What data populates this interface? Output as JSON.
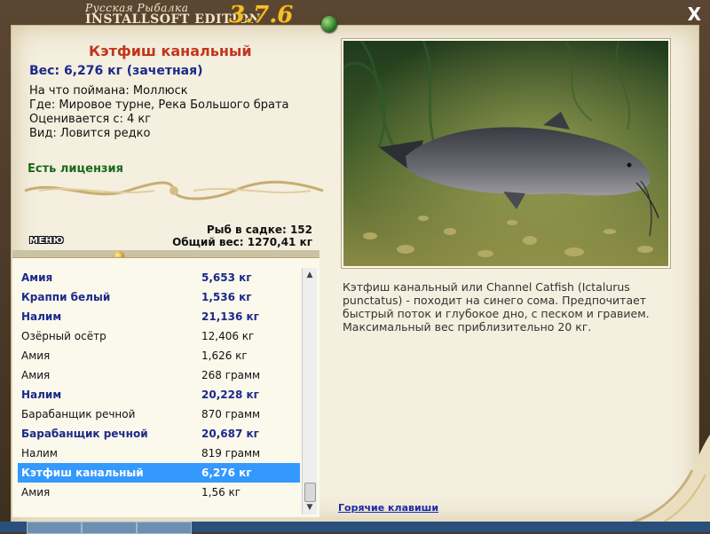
{
  "app": {
    "logo_line1": "Русская Рыбалка",
    "logo_line2": "INSTALLSOFT EDITION",
    "version": "3.7.6",
    "close_glyph": "X"
  },
  "fish": {
    "title": "Кэтфиш канальный",
    "weight": "Вес: 6,276 кг (зачетная)",
    "caught_on": "На что поймана: Моллюск",
    "where": "Где: Мировое турне, Река Большого брата",
    "valued_from": "Оценивается с: 4 кг",
    "kind": "Вид: Ловится редко",
    "license": "Есть лицензия",
    "description": "Кэтфиш канальный или Channel Catfish (Ictalurus punctatus) - походит на синего сома. Предпочитает быстрый поток и глубокое дно, с песком и гравием. Максимальный вес приблизительно 20 кг."
  },
  "menu_label": "МЕНЮ",
  "stats": {
    "fish_in_keepnet": "Рыб в садке: 152",
    "total_weight": "Общий вес: 1270,41 кг"
  },
  "hotkeys_label": "Горячие клавиши",
  "catch_list": [
    {
      "name": "Амия",
      "weight": "5,653 кг",
      "trophy": true,
      "selected": false
    },
    {
      "name": "Краппи белый",
      "weight": "1,536 кг",
      "trophy": true,
      "selected": false
    },
    {
      "name": "Налим",
      "weight": "21,136 кг",
      "trophy": true,
      "selected": false
    },
    {
      "name": "Озёрный осётр",
      "weight": "12,406 кг",
      "trophy": false,
      "selected": false
    },
    {
      "name": "Амия",
      "weight": "1,626 кг",
      "trophy": false,
      "selected": false
    },
    {
      "name": "Амия",
      "weight": "268 грамм",
      "trophy": false,
      "selected": false
    },
    {
      "name": "Налим",
      "weight": "20,228 кг",
      "trophy": true,
      "selected": false
    },
    {
      "name": "Барабанщик речной",
      "weight": "870 грамм",
      "trophy": false,
      "selected": false
    },
    {
      "name": "Барабанщик речной",
      "weight": "20,687 кг",
      "trophy": true,
      "selected": false
    },
    {
      "name": "Налим",
      "weight": "819 грамм",
      "trophy": false,
      "selected": false
    },
    {
      "name": "Кэтфиш канальный",
      "weight": "6,276 кг",
      "trophy": true,
      "selected": true
    },
    {
      "name": "Амия",
      "weight": "1,56 кг",
      "trophy": false,
      "selected": false
    }
  ],
  "colors": {
    "title_red": "#c2351b",
    "trophy_blue": "#1b2a8a",
    "license_green": "#1a6a1a",
    "selection": "#3399ff",
    "version_gold": "#f0c030"
  }
}
